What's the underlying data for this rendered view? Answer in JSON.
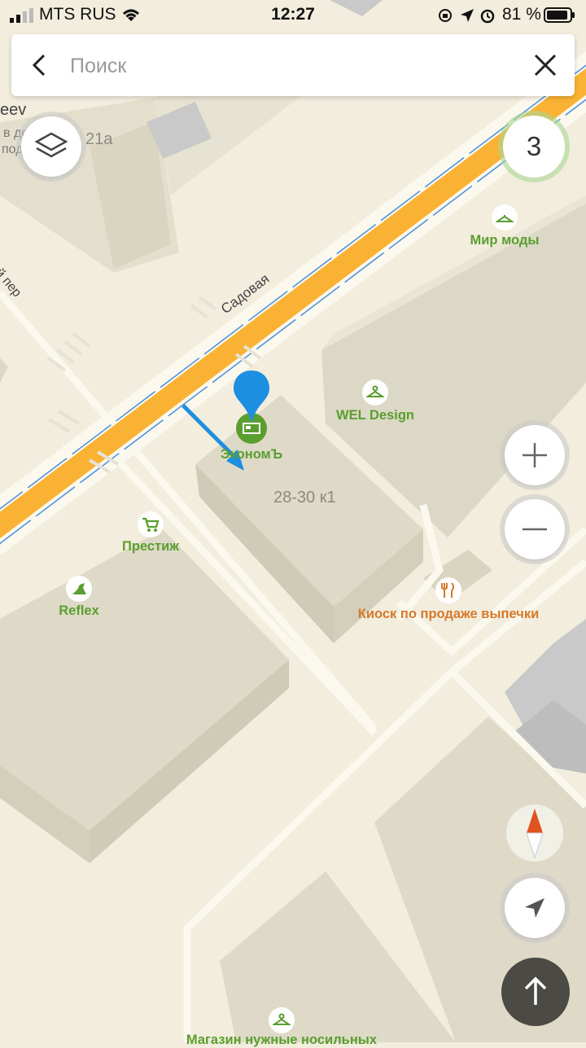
{
  "status": {
    "carrier": "MTS RUS",
    "time": "12:27",
    "battery": "81 %"
  },
  "search": {
    "placeholder": "Поиск"
  },
  "traffic_level": "3",
  "map": {
    "street": "Садовая",
    "lane": "ий пер",
    "edge_text": "eev",
    "edge_sub1": "в де",
    "edge_sub2": "под",
    "building_21a": "21а",
    "building_main": "28-30 к1",
    "poi": {
      "mir_mody": "Мир моды",
      "wel_design": "WEL Design",
      "ekonom": "ЭкономЪ",
      "prestizh": "Престиж",
      "reflex": "Reflex",
      "kiosk": "Киоск по продаже выпечки",
      "bottom_shop": "Магазин нужные носильных"
    }
  },
  "colors": {
    "road": "#f9b233",
    "green": "#5a9e2f",
    "pin": "#1d8fe0",
    "orange": "#d6792a"
  }
}
